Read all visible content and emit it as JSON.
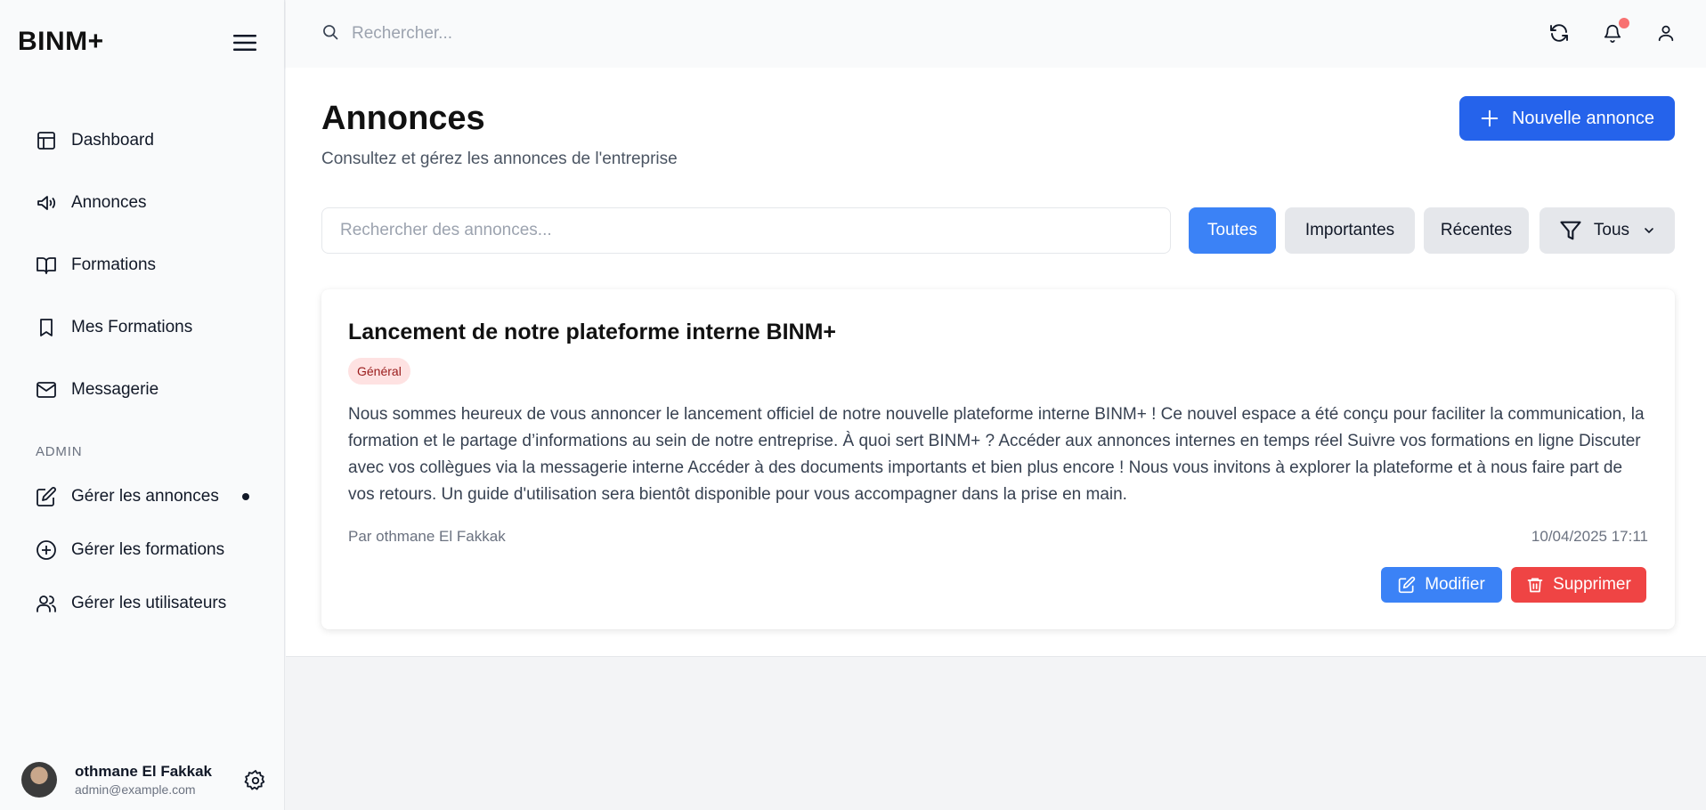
{
  "sidebar": {
    "brand": "BINM+",
    "items": [
      {
        "label": "Dashboard",
        "icon": "layout-icon"
      },
      {
        "label": "Annonces",
        "icon": "megaphone-icon"
      },
      {
        "label": "Formations",
        "icon": "book-open-icon"
      },
      {
        "label": "Mes Formations",
        "icon": "bookmark-icon"
      },
      {
        "label": "Messagerie",
        "icon": "mail-icon"
      }
    ],
    "admin_section": "ADMIN",
    "admin_items": [
      {
        "label": "Gérer les annonces",
        "icon": "edit-square-icon"
      },
      {
        "label": "Gérer les formations",
        "icon": "plus-circle-icon"
      },
      {
        "label": "Gérer les utilisateurs",
        "icon": "users-icon"
      }
    ],
    "user": {
      "name": "othmane El Fakkak",
      "email": "admin@example.com"
    }
  },
  "topbar": {
    "search_placeholder": "Rechercher...",
    "icons": [
      "refresh-icon",
      "bell-icon",
      "user-icon"
    ]
  },
  "main": {
    "title": "Annonces",
    "subtitle": "Consultez et gérez les annonces de l'entreprise",
    "new_button": "Nouvelle annonce",
    "filter_placeholder": "Rechercher des annonces...",
    "filters": [
      "Toutes",
      "Importantes",
      "Récentes"
    ],
    "active_filter": "Toutes",
    "dropdown_value": "Tous",
    "announcement": {
      "title": "Lancement de notre plateforme interne BINM+",
      "category": "Général",
      "body": "Nous sommes heureux de vous annoncer le lancement officiel de notre nouvelle plateforme interne BINM+ ! Ce nouvel espace a été conçu pour faciliter la communication, la formation et le partage d’informations au sein de notre entreprise. À quoi sert BINM+ ? Accéder aux annonces internes en temps réel Suivre vos formations en ligne Discuter avec vos collègues via la messagerie interne Accéder à des documents importants et bien plus encore ! Nous vous invitons à explorer la plateforme et à nous faire part de vos retours. Un guide d'utilisation sera bientôt disponible pour vous accompagner dans la prise en main.",
      "author": "Par othmane El Fakkak",
      "date": "10/04/2025 17:11",
      "edit_label": "Modifier",
      "delete_label": "Supprimer"
    }
  },
  "colors": {
    "primary": "#2563eb",
    "active_chip": "#3b82f6",
    "danger": "#ef4444",
    "badge_bg": "#fee2e2",
    "badge_text": "#991b1b",
    "notification": "#f87171"
  }
}
